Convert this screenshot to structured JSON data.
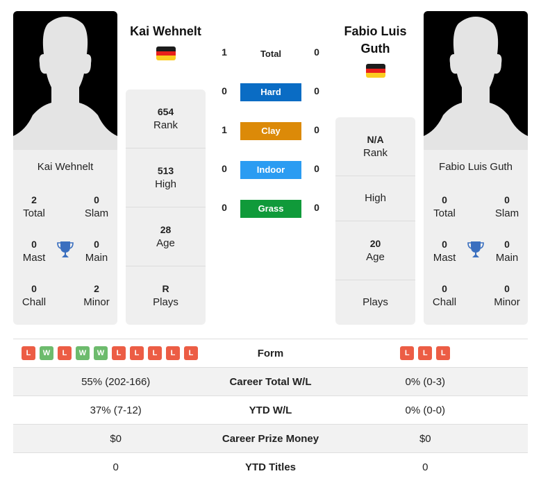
{
  "player1": {
    "name": "Kai Wehnelt",
    "card_name": "Kai Wehnelt",
    "country": "Germany",
    "titles": {
      "total": {
        "value": "2",
        "label": "Total"
      },
      "slam": {
        "value": "0",
        "label": "Slam"
      },
      "mast": {
        "value": "0",
        "label": "Mast"
      },
      "main": {
        "value": "0",
        "label": "Main"
      },
      "chall": {
        "value": "0",
        "label": "Chall"
      },
      "minor": {
        "value": "2",
        "label": "Minor"
      }
    },
    "stats": [
      {
        "value": "654",
        "label": "Rank"
      },
      {
        "value": "513",
        "label": "High"
      },
      {
        "value": "28",
        "label": "Age"
      },
      {
        "value": "R",
        "label": "Plays"
      }
    ],
    "form": [
      "L",
      "W",
      "L",
      "W",
      "W",
      "L",
      "L",
      "L",
      "L",
      "L"
    ]
  },
  "player2": {
    "name": "Fabio Luis Guth",
    "card_name": "Fabio Luis Guth",
    "country": "Germany",
    "titles": {
      "total": {
        "value": "0",
        "label": "Total"
      },
      "slam": {
        "value": "0",
        "label": "Slam"
      },
      "mast": {
        "value": "0",
        "label": "Mast"
      },
      "main": {
        "value": "0",
        "label": "Main"
      },
      "chall": {
        "value": "0",
        "label": "Chall"
      },
      "minor": {
        "value": "0",
        "label": "Minor"
      }
    },
    "stats": [
      {
        "value": "N/A",
        "label": "Rank"
      },
      {
        "value": "",
        "label": "High"
      },
      {
        "value": "20",
        "label": "Age"
      },
      {
        "value": "",
        "label": "Plays"
      }
    ],
    "form": [
      "L",
      "L",
      "L"
    ]
  },
  "h2h": {
    "total": {
      "label": "Total",
      "p1": "1",
      "p2": "0"
    },
    "surfaces": [
      {
        "label": "Hard",
        "p1": "0",
        "p2": "0",
        "color": "#0a6cc4"
      },
      {
        "label": "Clay",
        "p1": "1",
        "p2": "0",
        "color": "#dc8a08"
      },
      {
        "label": "Indoor",
        "p1": "0",
        "p2": "0",
        "color": "#2b9cf2"
      },
      {
        "label": "Grass",
        "p1": "0",
        "p2": "0",
        "color": "#109a3a"
      }
    ]
  },
  "comparison": [
    {
      "label": "Form",
      "p1": "",
      "p2": ""
    },
    {
      "label": "Career Total W/L",
      "p1": "55% (202-166)",
      "p2": "0% (0-3)"
    },
    {
      "label": "YTD W/L",
      "p1": "37% (7-12)",
      "p2": "0% (0-0)"
    },
    {
      "label": "Career Prize Money",
      "p1": "$0",
      "p2": "$0"
    },
    {
      "label": "YTD Titles",
      "p1": "0",
      "p2": "0"
    }
  ],
  "colors": {
    "loss": "#ec5d45",
    "win": "#6dbb6d",
    "trophy": "#3a6fbf"
  }
}
